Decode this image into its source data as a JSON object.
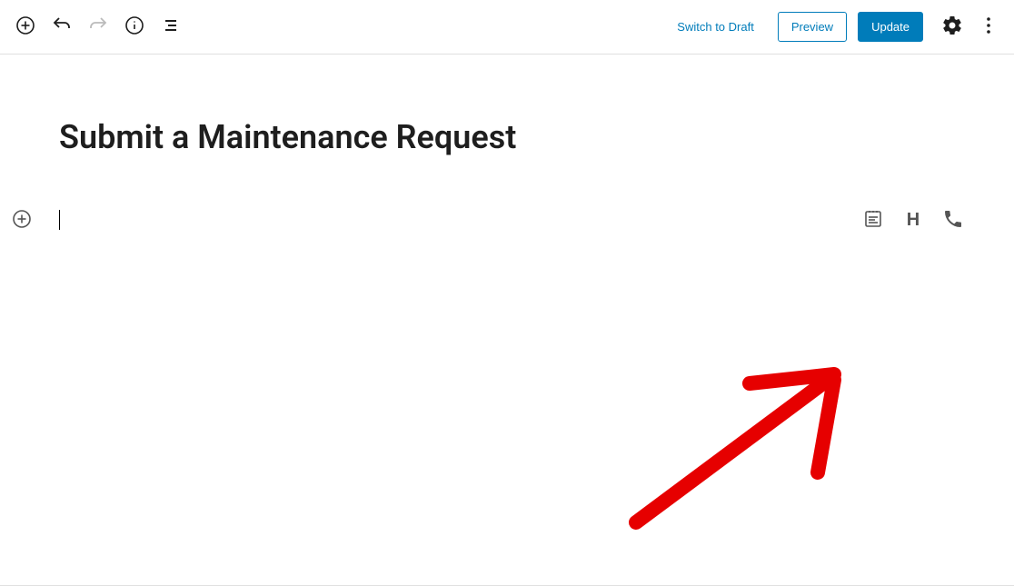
{
  "topbar": {
    "switch_draft": "Switch to Draft",
    "preview": "Preview",
    "update": "Update"
  },
  "editor": {
    "title": "Submit a Maintenance Request"
  },
  "suggestions": {
    "heading_glyph": "H"
  },
  "colors": {
    "accent": "#007cba",
    "annotation": "#e60000"
  }
}
